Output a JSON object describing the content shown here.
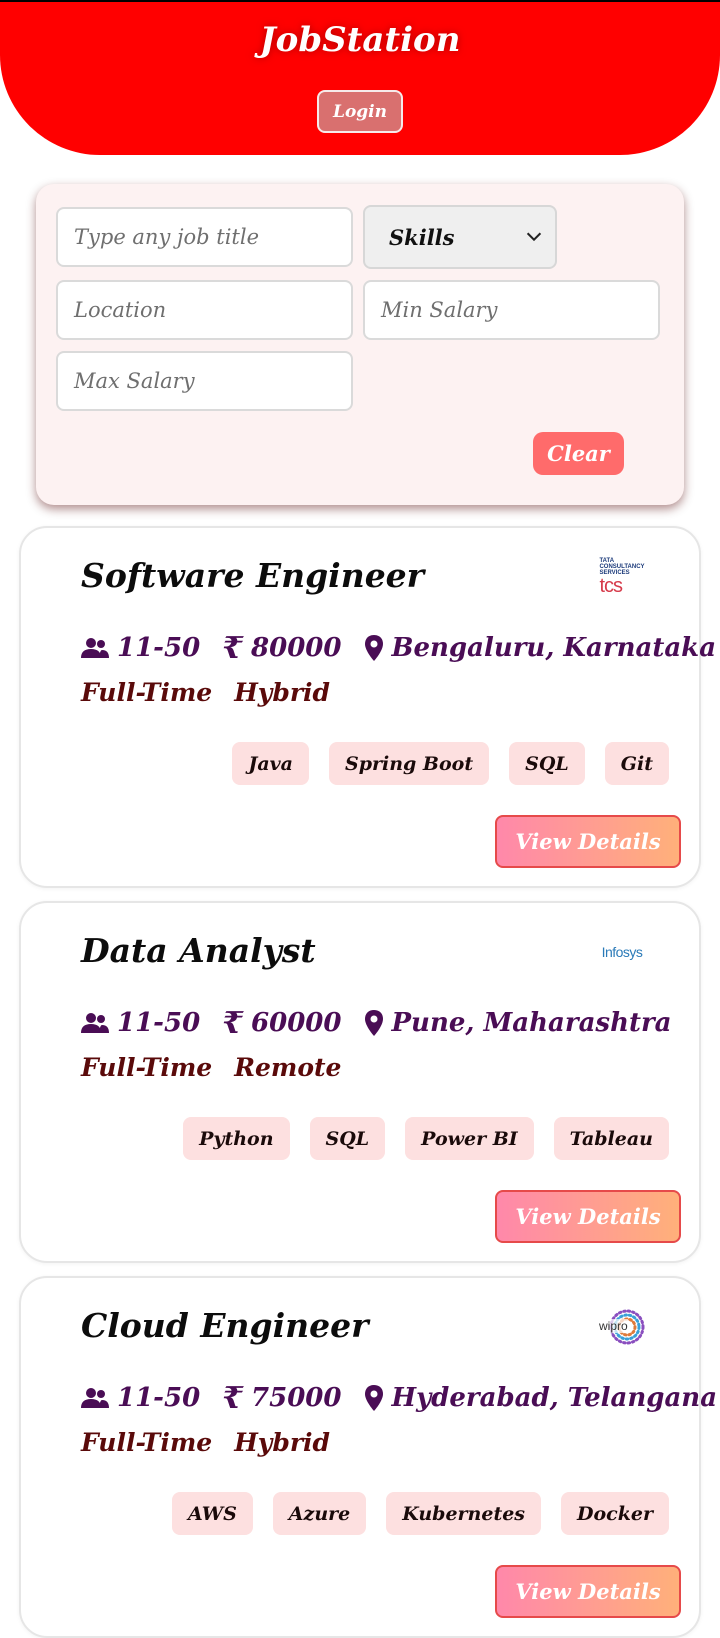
{
  "header": {
    "brand": "JobStation",
    "login_label": "Login",
    "color": "#ff0000"
  },
  "filters": {
    "job_title_placeholder": "Type any job title",
    "skills_selected": "Skills",
    "location_placeholder": "Location",
    "min_salary_placeholder": "Min Salary",
    "max_salary_placeholder": "Max Salary",
    "clear_label": "Clear"
  },
  "jobs": [
    {
      "title": "Software Engineer",
      "company_logo": "tcs-logo",
      "logo_text_top": "TATA\nCONSULTANCY\nSERVICES",
      "logo_text": "tcs",
      "team_size": "11-50",
      "salary": "80000",
      "location": "Bengaluru, Karnataka",
      "job_type": "Full-Time",
      "work_mode": "Hybrid",
      "skills": [
        "Java",
        "Spring Boot",
        "SQL",
        "Git"
      ],
      "view_label": "View Details"
    },
    {
      "title": "Data Analyst",
      "company_logo": "infosys-logo",
      "logo_text": "Infosys",
      "team_size": "11-50",
      "salary": "60000",
      "location": "Pune, Maharashtra",
      "job_type": "Full-Time",
      "work_mode": "Remote",
      "skills": [
        "Python",
        "SQL",
        "Power BI",
        "Tableau"
      ],
      "view_label": "View Details"
    },
    {
      "title": "Cloud Engineer",
      "company_logo": "wipro-logo",
      "logo_text": "wipro",
      "team_size": "11-50",
      "salary": "75000",
      "location": "Hyderabad, Telangana",
      "job_type": "Full-Time",
      "work_mode": "Hybrid",
      "skills": [
        "AWS",
        "Azure",
        "Kubernetes",
        "Docker"
      ],
      "view_label": "View Details"
    }
  ],
  "icons": {
    "team": "users-icon",
    "salary": "rupee-icon",
    "location": "map-pin-icon"
  },
  "colors": {
    "meta_text": "#4a0d55",
    "type_text": "#5a0a0a",
    "chip_bg": "#fde0e0",
    "clear_btn": "#ff6b6b"
  }
}
